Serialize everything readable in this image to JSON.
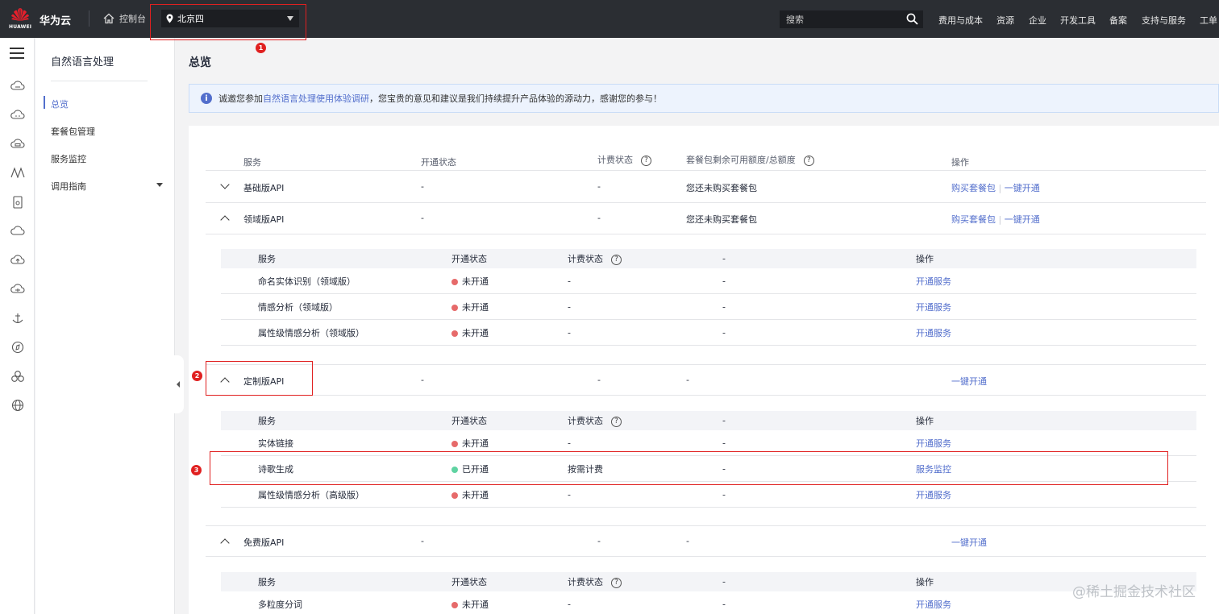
{
  "topbar": {
    "logo_text": "HUAWEI",
    "brand": "华为云",
    "console": "控制台",
    "region": "北京四",
    "search_placeholder": "搜索",
    "nav": [
      "费用与成本",
      "资源",
      "企业",
      "开发工具",
      "备案",
      "支持与服务",
      "工单"
    ]
  },
  "subnav": {
    "title": "自然语言处理",
    "items": [
      "总览",
      "套餐包管理",
      "服务监控",
      "调用指南"
    ]
  },
  "main": {
    "title": "总览",
    "notice": {
      "before": "诚邀您参加",
      "link": "自然语言处理使用体验调研",
      "after": "，您宝贵的意见和建议是我们持续提升产品体验的源动力，感谢您的参与！"
    },
    "table": {
      "headers": [
        "服务",
        "开通状态",
        "计费状态",
        "套餐包剩余可用额度/总额度",
        "操作"
      ],
      "help_icon": "?",
      "groups": [
        {
          "name": "基础版API",
          "status": "-",
          "billing": "-",
          "quota": "您还未购买套餐包",
          "action1": "购买套餐包",
          "action2": "一键开通"
        },
        {
          "name": "领域版API",
          "status": "-",
          "billing": "-",
          "quota": "您还未购买套餐包",
          "action1": "购买套餐包",
          "action2": "一键开通"
        },
        {
          "name": "定制版API",
          "status": "-",
          "billing": "-",
          "quota": "-",
          "action2": "一键开通"
        },
        {
          "name": "免费版API",
          "status": "-",
          "billing": "-",
          "quota": "-",
          "action2": "一键开通"
        }
      ],
      "pipe": "|",
      "sub_headers": [
        "服务",
        "开通状态",
        "计费状态",
        "-",
        "操作"
      ],
      "domain_rows": [
        {
          "name": "命名实体识别（领域版）",
          "status": "未开通",
          "billing": "-",
          "col4": "-",
          "action": "开通服务"
        },
        {
          "name": "情感分析（领域版）",
          "status": "未开通",
          "billing": "-",
          "col4": "-",
          "action": "开通服务"
        },
        {
          "name": "属性级情感分析（领域版）",
          "status": "未开通",
          "billing": "-",
          "col4": "-",
          "action": "开通服务"
        }
      ],
      "custom_rows": [
        {
          "name": "实体链接",
          "status": "未开通",
          "billing": "-",
          "col4": "-",
          "action": "开通服务"
        },
        {
          "name": "诗歌生成",
          "status": "已开通",
          "billing": "按需计费",
          "col4": "-",
          "action": "服务监控"
        },
        {
          "name": "属性级情感分析（高级版）",
          "status": "未开通",
          "billing": "-",
          "col4": "-",
          "action": "开通服务"
        }
      ],
      "free_rows": [
        {
          "name": "多粒度分词",
          "status": "未开通",
          "billing": "-",
          "col4": "-",
          "action": "开通服务"
        }
      ]
    }
  },
  "annotations": [
    "1",
    "2",
    "3"
  ],
  "watermark": "@稀土掘金技术社区",
  "colors": {
    "topbar": "#2b2e33",
    "link": "#526ecc",
    "off": "#e66a6a",
    "on": "#5fd3a2",
    "annotation": "#e02020"
  }
}
